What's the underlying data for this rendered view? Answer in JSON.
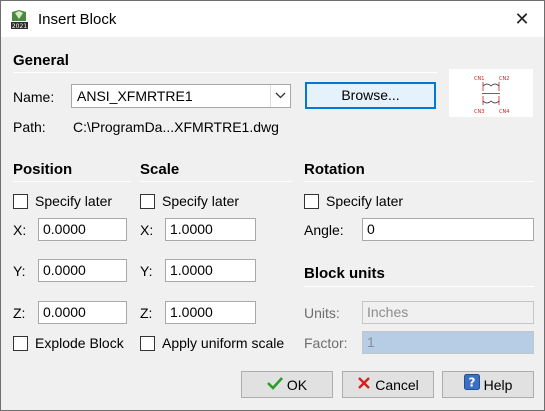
{
  "window": {
    "title": "Insert Block",
    "close_glyph": "✕"
  },
  "icons": {
    "app": "autocad-app-icon",
    "close": "close-icon",
    "ok": "checkmark-icon",
    "cancel": "x-mark-icon",
    "help": "question-icon",
    "combo": "chevron-down-icon"
  },
  "general": {
    "heading": "General",
    "name_label": "Name:",
    "name_value": "ANSI_XFMRTRE1",
    "browse_label": "Browse...",
    "path_label": "Path:",
    "path_value": "C:\\ProgramDa...XFMRTRE1.dwg",
    "preview": {
      "pins": [
        "CN1",
        "CN2",
        "CN3",
        "CN4"
      ]
    }
  },
  "position": {
    "heading": "Position",
    "specify_later": "Specify later",
    "x_label": "X:",
    "x_value": "0.0000",
    "y_label": "Y:",
    "y_value": "0.0000",
    "z_label": "Z:",
    "z_value": "0.0000",
    "explode_label": "Explode Block"
  },
  "scale": {
    "heading": "Scale",
    "specify_later": "Specify later",
    "x_label": "X:",
    "x_value": "1.0000",
    "y_label": "Y:",
    "y_value": "1.0000",
    "z_label": "Z:",
    "z_value": "1.0000",
    "uniform_label": "Apply uniform scale"
  },
  "rotation": {
    "heading": "Rotation",
    "specify_later": "Specify later",
    "angle_label": "Angle:",
    "angle_value": "0"
  },
  "block_units": {
    "heading": "Block units",
    "units_label": "Units:",
    "units_value": "Inches",
    "factor_label": "Factor:",
    "factor_value": "1"
  },
  "buttons": {
    "ok": "OK",
    "cancel": "Cancel",
    "help": "Help"
  },
  "colors": {
    "focus_border": "#0078d7",
    "ok_green": "#2a9d2a",
    "cancel_red": "#d42020",
    "help_blue": "#3a6fc4"
  }
}
